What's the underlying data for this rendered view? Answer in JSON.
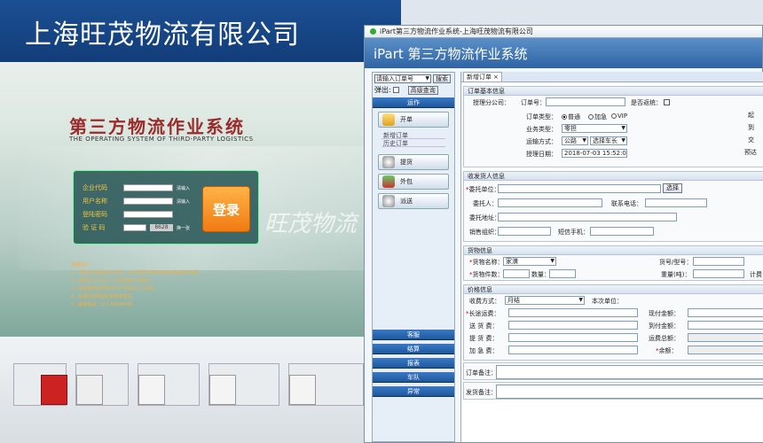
{
  "login": {
    "company": "上海旺茂物流有限公司",
    "system_title": "第三方物流作业系统",
    "system_subtitle": "THE OPERATING SYSTEM OF THIRD-PARTY LOGISTICS",
    "watermark": "旺茂物流",
    "fields": [
      {
        "label": "企业代码",
        "note": "清输入"
      },
      {
        "label": "用户名称",
        "note": "清输入"
      },
      {
        "label": "登陆密码",
        "note": ""
      },
      {
        "label": "验 证 码",
        "note": "换一张"
      }
    ],
    "captcha": "8628",
    "login_button": "登录",
    "tips_title": "温馨提示：",
    "tips": [
      "1、清先核对您的企业代码，企业代码在您注册成功后由系统分配。",
      "2、密码区分大小写，请注意输入法状态。",
      "3、建议使用分辨率1024*768及以上浏览。",
      "4、如遇问题请联系系统管理员。",
      "5、客服电话：021-59598455"
    ]
  },
  "ipart": {
    "window_title": "iPart第三方物流作业系统-上海旺茂物流有限公司",
    "header_title": "iPart 第三方物流作业系统",
    "search_select": "请输入订单号",
    "search_button": "搜索",
    "popup_label": "弹出:",
    "advanced_search": "高级查询",
    "section_ops": "运作",
    "ops": [
      {
        "label": "开单",
        "subitems": [
          "新增订单",
          "历史订单"
        ]
      },
      {
        "label": "提货",
        "subitems": []
      },
      {
        "label": "外包",
        "subitems": []
      },
      {
        "label": "派送",
        "subitems": []
      }
    ],
    "bottom_sections": [
      "客服",
      "结算",
      "报表",
      "车队",
      "异常"
    ],
    "tab_label": "新增订单",
    "order_info": {
      "header": "订单基本信息",
      "branch_label": "授理分公司：",
      "order_no_label": "订单号：",
      "return_label": "是否返统：",
      "type_label": "订单类型：",
      "type_options": [
        "普通",
        "加急",
        "VIP"
      ],
      "type_selected": 0,
      "business_label": "业务类型：",
      "business_value": "零担",
      "transport_label": "运输方式：",
      "transport_value": "公路",
      "vehicle_value": "选择车长",
      "date_label": "授理日期：",
      "date_value": "2018-07-03 15:52:02",
      "right_labels": [
        "起",
        "到",
        "交",
        "预达"
      ]
    },
    "party_info": {
      "header": "收发货人信息",
      "consignor_unit_label": "委托单位：",
      "select_button": "选择",
      "consignor_label": "委托人：",
      "phone_label": "联系电话：",
      "address_label": "委托地址：",
      "sales_org_label": "销售组织：",
      "sms_label": "短信手机："
    },
    "goods_info": {
      "header": "货物信息",
      "name_label": "货物名称：",
      "name_value": "家潢",
      "model_label": "货号/型号：",
      "pieces_label": "货物件数：",
      "qty_label": "数量：",
      "weight_label": "重量(吨)：",
      "billing_label": "计费"
    },
    "price_info": {
      "header": "价格信息",
      "method_label": "收费方式：",
      "method_value": "月结",
      "unit_label": "本次单位：",
      "left_fees": [
        "长途运费：",
        "送 货 费：",
        "提 货 费：",
        "加 急 费："
      ],
      "right_fees": [
        "现付金额：",
        "到付金额：",
        "运费总额：",
        "余额："
      ]
    },
    "order_note_label": "订单备注：",
    "ship_note_label": "发货备注："
  }
}
